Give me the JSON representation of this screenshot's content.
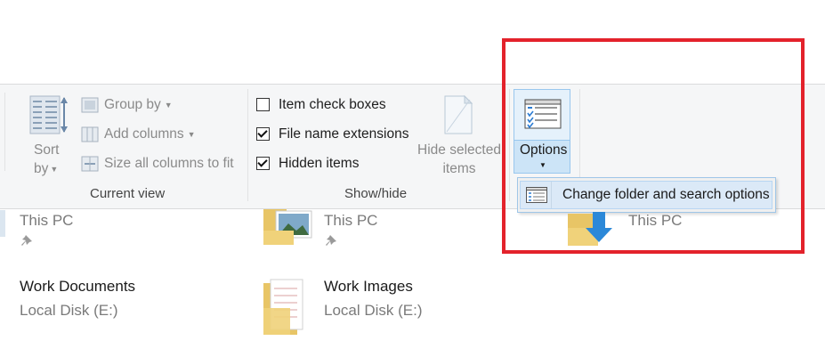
{
  "ribbon": {
    "sort_label_1": "Sort",
    "sort_label_2": "by",
    "group_by": "Group by",
    "add_columns": "Add columns",
    "size_all_columns": "Size all columns to fit",
    "current_view_label": "Current view",
    "item_check_boxes": "Item check boxes",
    "file_name_extensions": "File name extensions",
    "hidden_items": "Hidden items",
    "hide_selected_1": "Hide selected",
    "hide_selected_2": "items",
    "show_hide_label": "Show/hide",
    "options": "Options",
    "checkboxes": {
      "item_check_boxes": false,
      "file_name_extensions": true,
      "hidden_items": true
    }
  },
  "dropdown": {
    "change_folder_options": "Change folder and search options"
  },
  "files": {
    "item1_title": "This PC",
    "item2_title": "This PC",
    "item3_title": "This PC",
    "work_documents_title": "Work Documents",
    "work_documents_sub": "Local Disk (E:)",
    "work_images_title": "Work Images",
    "work_images_sub": "Local Disk (E:)"
  },
  "colors": {
    "annotation_red": "#e3222b",
    "options_highlight": "#cce4f7"
  }
}
